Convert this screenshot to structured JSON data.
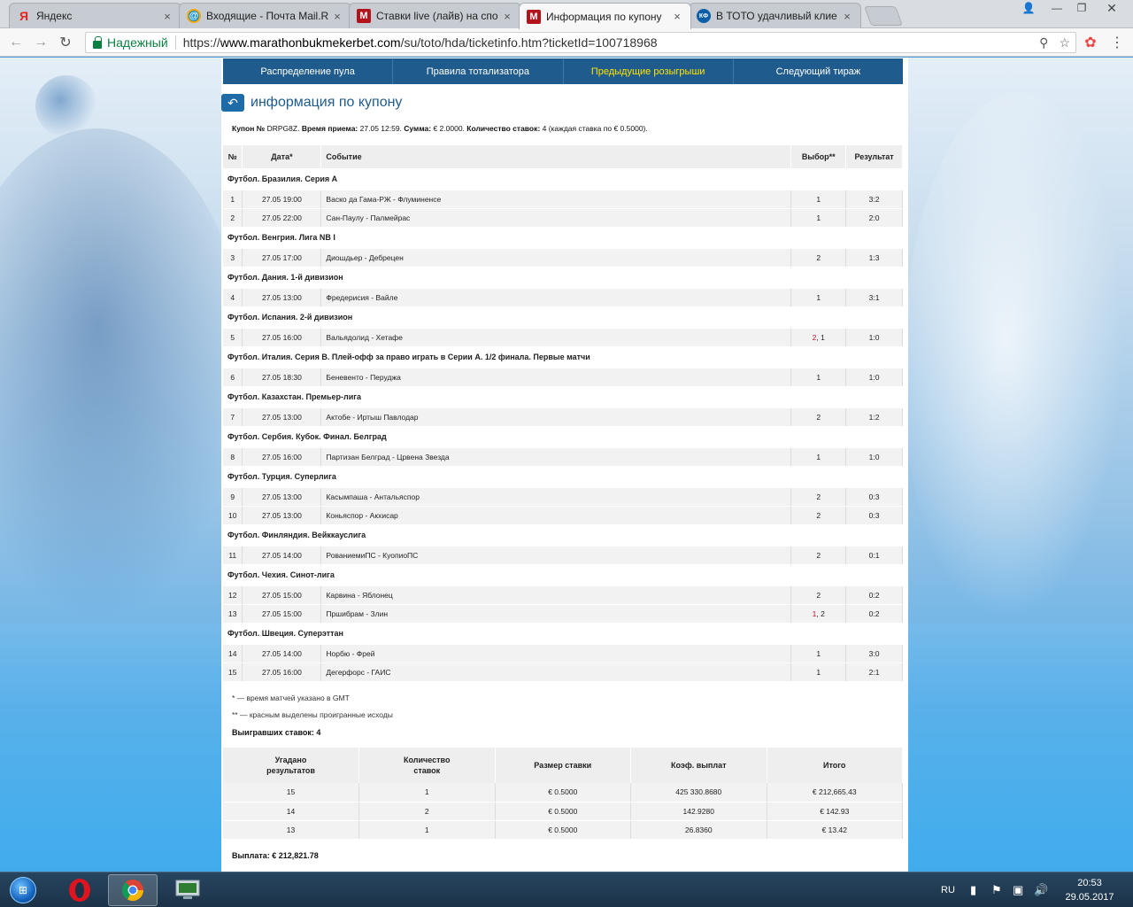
{
  "browser": {
    "tabs": [
      {
        "title": "Яндекс",
        "icon": "yandex-icon",
        "active": false
      },
      {
        "title": "Входящие - Почта Mail.R",
        "icon": "mail-icon",
        "active": false
      },
      {
        "title": "Ставки live (лайв) на спо",
        "icon": "marathon-icon",
        "active": false
      },
      {
        "title": "Информация по купону",
        "icon": "marathon-icon",
        "active": true
      },
      {
        "title": "В ТОТО удачливый клие",
        "icon": "kf-icon",
        "active": false
      }
    ],
    "secure_label": "Надежный",
    "url_prefix": "https://",
    "url_host": "www.marathonbukmekerbet.com",
    "url_path": "/su/toto/hda/ticketinfo.htm?ticketId=100718968"
  },
  "menu": [
    {
      "label": "Распределение пула",
      "active": false
    },
    {
      "label": "Правила тотализатора",
      "active": false
    },
    {
      "label": "Предыдущие розыгрыши",
      "active": true
    },
    {
      "label": "Следующий тираж",
      "active": false
    }
  ],
  "page_title": "информация по купону",
  "coupon": {
    "number_label": "Купон №",
    "number": "DRPG8Z.",
    "time_label": "Время приема:",
    "time": "27.05 12:59.",
    "sum_label": "Сумма:",
    "sum": "€ 2.0000.",
    "count_label": "Количество ставок:",
    "count": "4",
    "each": "(каждая ставка по € 0.5000)."
  },
  "bets_headers": [
    "№",
    "Дата*",
    "Событие",
    "Выбор**",
    "Результат"
  ],
  "leagues": [
    {
      "name": "Футбол. Бразилия. Серия А",
      "rows": [
        {
          "n": "1",
          "date": "27.05 19:00",
          "event": "Васко да Гама-РЖ - Флуминенсе",
          "choice": [
            {
              "v": "1",
              "lost": false
            }
          ],
          "result": "3:2"
        },
        {
          "n": "2",
          "date": "27.05 22:00",
          "event": "Сан-Паулу - Палмейрас",
          "choice": [
            {
              "v": "1",
              "lost": false
            }
          ],
          "result": "2:0"
        }
      ]
    },
    {
      "name": "Футбол. Венгрия. Лига NB I",
      "rows": [
        {
          "n": "3",
          "date": "27.05 17:00",
          "event": "Диошдьер - Дебрецен",
          "choice": [
            {
              "v": "2",
              "lost": false
            }
          ],
          "result": "1:3"
        }
      ]
    },
    {
      "name": "Футбол. Дания. 1-й дивизион",
      "rows": [
        {
          "n": "4",
          "date": "27.05 13:00",
          "event": "Фредерисия - Вайле",
          "choice": [
            {
              "v": "1",
              "lost": false
            }
          ],
          "result": "3:1"
        }
      ]
    },
    {
      "name": "Футбол. Испания. 2-й дивизион",
      "rows": [
        {
          "n": "5",
          "date": "27.05 16:00",
          "event": "Вальядолид - Хетафе",
          "choice": [
            {
              "v": "2",
              "lost": true
            },
            {
              "v": "1",
              "lost": false
            }
          ],
          "result": "1:0"
        }
      ]
    },
    {
      "name": "Футбол. Италия. Серия B. Плей-офф за право играть в Серии А. 1/2 финала. Первые матчи",
      "rows": [
        {
          "n": "6",
          "date": "27.05 18:30",
          "event": "Беневенто - Перуджа",
          "choice": [
            {
              "v": "1",
              "lost": false
            }
          ],
          "result": "1:0"
        }
      ]
    },
    {
      "name": "Футбол. Казахстан. Премьер-лига",
      "rows": [
        {
          "n": "7",
          "date": "27.05 13:00",
          "event": "Актобе - Иртыш Павлодар",
          "choice": [
            {
              "v": "2",
              "lost": false
            }
          ],
          "result": "1:2"
        }
      ]
    },
    {
      "name": "Футбол. Сербия. Кубок. Финал. Белград",
      "rows": [
        {
          "n": "8",
          "date": "27.05 16:00",
          "event": "Партизан Белград - Црвена Звезда",
          "choice": [
            {
              "v": "1",
              "lost": false
            }
          ],
          "result": "1:0"
        }
      ]
    },
    {
      "name": "Футбол. Турция. Суперлига",
      "rows": [
        {
          "n": "9",
          "date": "27.05 13:00",
          "event": "Касымпаша - Антальяспор",
          "choice": [
            {
              "v": "2",
              "lost": false
            }
          ],
          "result": "0:3"
        },
        {
          "n": "10",
          "date": "27.05 13:00",
          "event": "Коньяспор - Акхисар",
          "choice": [
            {
              "v": "2",
              "lost": false
            }
          ],
          "result": "0:3"
        }
      ]
    },
    {
      "name": "Футбол. Финляндия. Вейккауслига",
      "rows": [
        {
          "n": "11",
          "date": "27.05 14:00",
          "event": "РованиемиПС - КуопиоПС",
          "choice": [
            {
              "v": "2",
              "lost": false
            }
          ],
          "result": "0:1"
        }
      ]
    },
    {
      "name": "Футбол. Чехия. Синот-лига",
      "rows": [
        {
          "n": "12",
          "date": "27.05 15:00",
          "event": "Карвина - Яблонец",
          "choice": [
            {
              "v": "2",
              "lost": false
            }
          ],
          "result": "0:2"
        },
        {
          "n": "13",
          "date": "27.05 15:00",
          "event": "Пршибрам - Злин",
          "choice": [
            {
              "v": "1",
              "lost": true
            },
            {
              "v": "2",
              "lost": false
            }
          ],
          "result": "0:2"
        }
      ]
    },
    {
      "name": "Футбол. Швеция. Суперэттан",
      "rows": [
        {
          "n": "14",
          "date": "27.05 14:00",
          "event": "Норбю - Фрей",
          "choice": [
            {
              "v": "1",
              "lost": false
            }
          ],
          "result": "3:0"
        },
        {
          "n": "15",
          "date": "27.05 16:00",
          "event": "Дегерфорс - ГАИС",
          "choice": [
            {
              "v": "1",
              "lost": false
            }
          ],
          "result": "2:1"
        }
      ]
    }
  ],
  "notes": {
    "gmt": "* — время матчей указано в GMT",
    "red": "** — красным выделены проигранные исходы",
    "won": "Выигравших ставок: 4"
  },
  "payout_headers": [
    "Угадано\nрезультатов",
    "Количество\nставок",
    "Размер ставки",
    "Коэф. выплат",
    "Итого"
  ],
  "payout_rows": [
    [
      "15",
      "1",
      "€ 0.5000",
      "425 330.8680",
      "€ 212,665.43"
    ],
    [
      "14",
      "2",
      "€ 0.5000",
      "142.9280",
      "€ 142.93"
    ],
    [
      "13",
      "1",
      "€ 0.5000",
      "26.8360",
      "€ 13.42"
    ]
  ],
  "total": "Выплата: € 212,821.78",
  "taskbar": {
    "lang": "RU",
    "time": "20:53",
    "date": "29.05.2017"
  },
  "colors": {
    "menu_bg": "#1f5b8c",
    "menu_active": "#ffe400",
    "lost": "#c8102e",
    "secure": "#0b8043"
  }
}
